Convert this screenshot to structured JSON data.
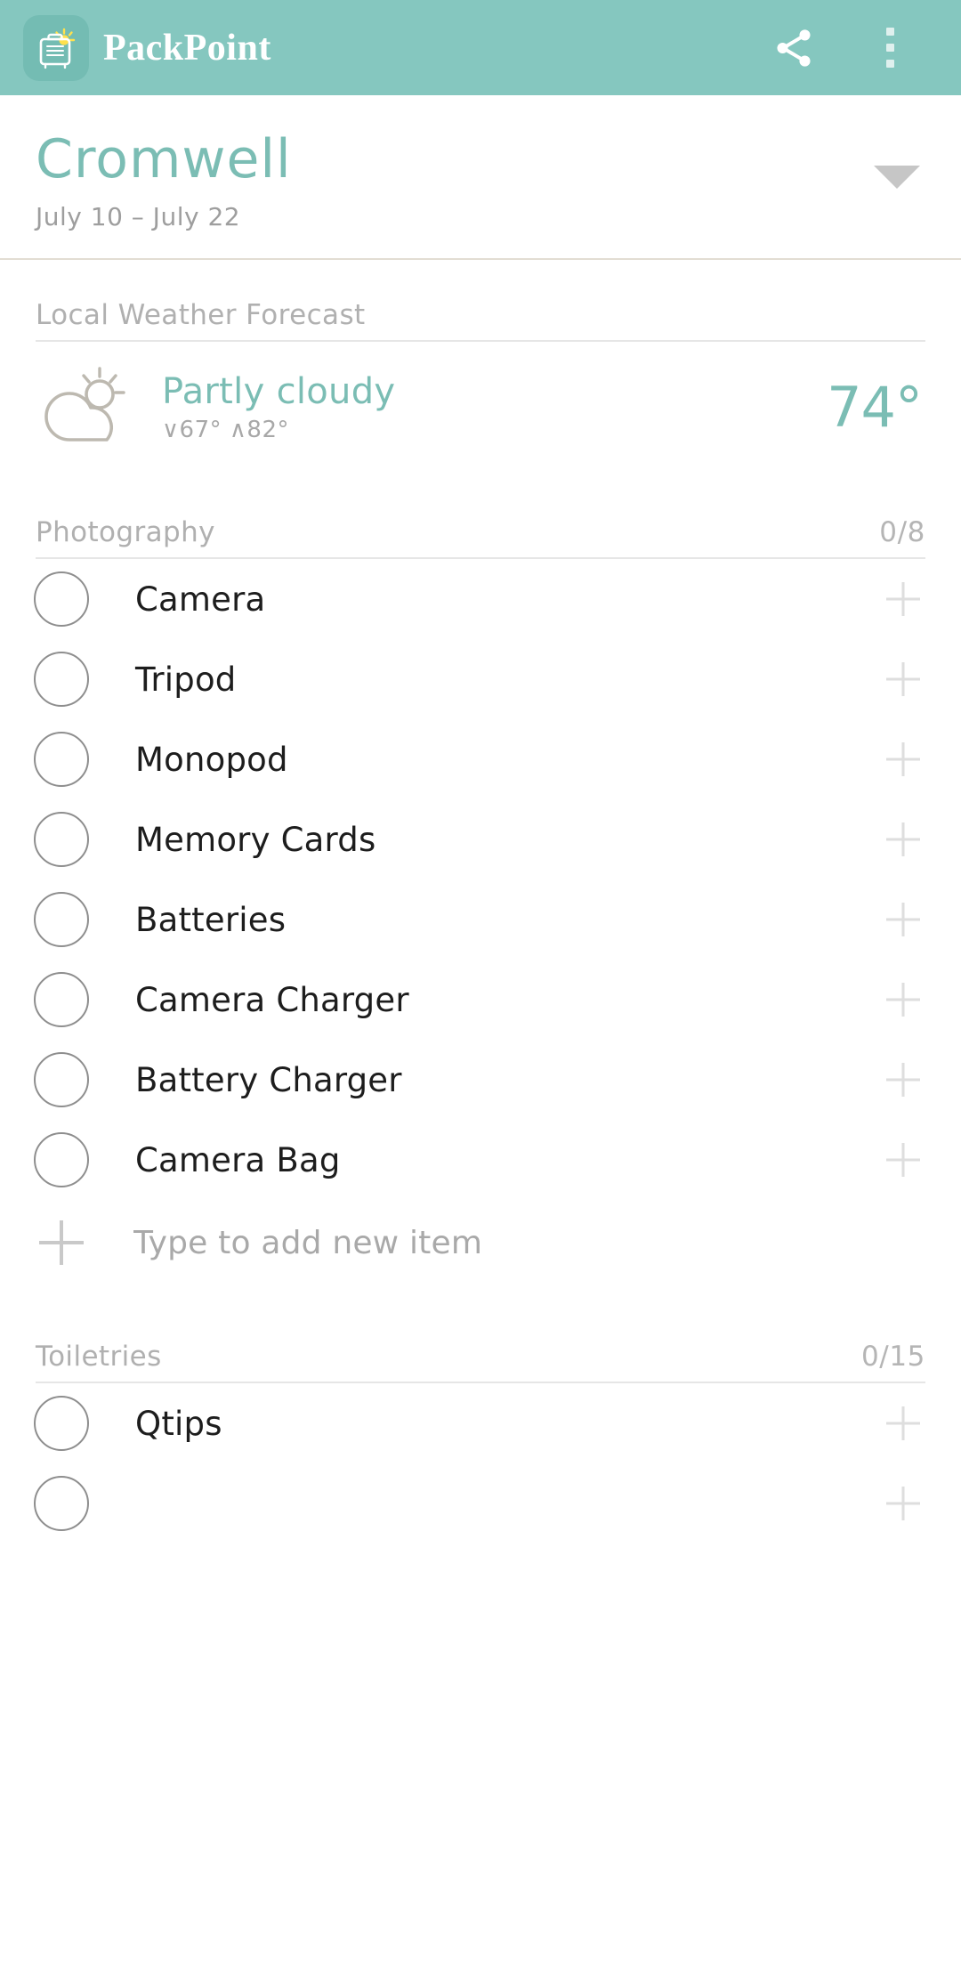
{
  "appbar": {
    "title": "PackPoint",
    "logo_icon": "suitcase-sun-logo",
    "share_icon": "share-icon",
    "overflow_icon": "more-vertical-icon"
  },
  "trip": {
    "name": "Cromwell",
    "dates": "July 10 – July 22",
    "dropdown_icon": "chevron-down-icon"
  },
  "weather": {
    "section_title": "Local Weather Forecast",
    "icon": "partly-cloudy-icon",
    "condition": "Partly cloudy",
    "range": "∨67° ∧82°",
    "temperature": "74°"
  },
  "add_item": {
    "placeholder": "Type to add new item",
    "value": "",
    "icon": "plus-icon"
  },
  "colors": {
    "accent": "#7bbdb4",
    "appbar": "#85c7bf",
    "logo_tile": "#74bcb3",
    "muted_text": "#b0b0b0",
    "item_text": "#1d1d1d",
    "plus_icon": "#dedede"
  },
  "categories": [
    {
      "title": "Photography",
      "count": "0/8",
      "items": [
        {
          "label": "Camera",
          "checked": false,
          "add_icon": "plus-icon"
        },
        {
          "label": "Tripod",
          "checked": false,
          "add_icon": "plus-icon"
        },
        {
          "label": "Monopod",
          "checked": false,
          "add_icon": "plus-icon"
        },
        {
          "label": "Memory Cards",
          "checked": false,
          "add_icon": "plus-icon"
        },
        {
          "label": "Batteries",
          "checked": false,
          "add_icon": "plus-icon"
        },
        {
          "label": "Camera Charger",
          "checked": false,
          "add_icon": "plus-icon"
        },
        {
          "label": "Battery Charger",
          "checked": false,
          "add_icon": "plus-icon"
        },
        {
          "label": "Camera Bag",
          "checked": false,
          "add_icon": "plus-icon"
        }
      ]
    },
    {
      "title": "Toiletries",
      "count": "0/15",
      "items": [
        {
          "label": "Qtips",
          "checked": false,
          "add_icon": "plus-icon"
        }
      ]
    }
  ]
}
